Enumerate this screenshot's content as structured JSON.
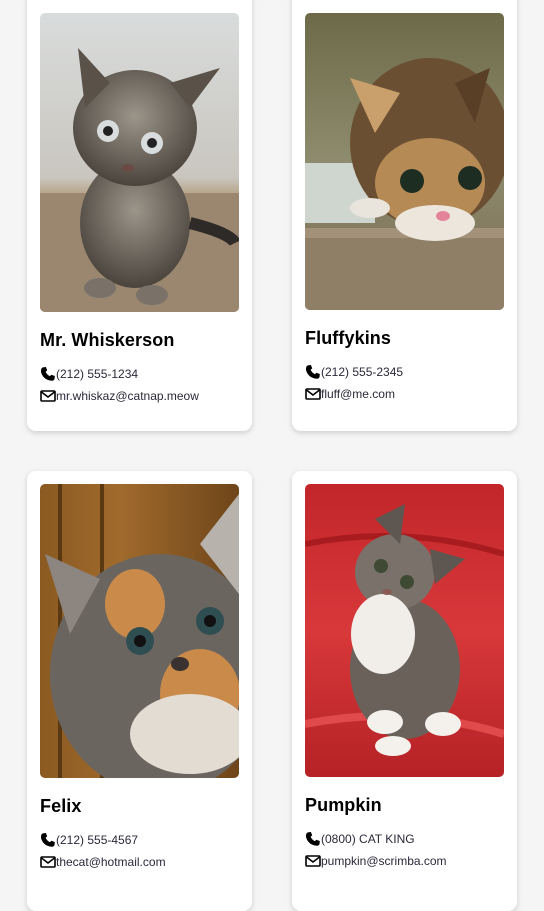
{
  "cards": [
    {
      "name": "Mr. Whiskerson",
      "phone": "(212) 555-1234",
      "email": "mr.whiskaz@catnap.meow",
      "photo_icon": "kitten-photo"
    },
    {
      "name": "Fluffykins",
      "phone": "(212) 555-2345",
      "email": "fluff@me.com",
      "photo_icon": "kitten-photo"
    },
    {
      "name": "Felix",
      "phone": "(212) 555-4567",
      "email": "thecat@hotmail.com",
      "photo_icon": "kitten-photo"
    },
    {
      "name": "Pumpkin",
      "phone": "(0800) CAT KING",
      "email": "pumpkin@scrimba.com",
      "photo_icon": "kitten-photo"
    }
  ],
  "icons": {
    "phone": "phone-icon",
    "email": "envelope-icon"
  },
  "colors": {
    "background": "#f5f5f5",
    "card": "#ffffff",
    "text": "#2b283a"
  }
}
